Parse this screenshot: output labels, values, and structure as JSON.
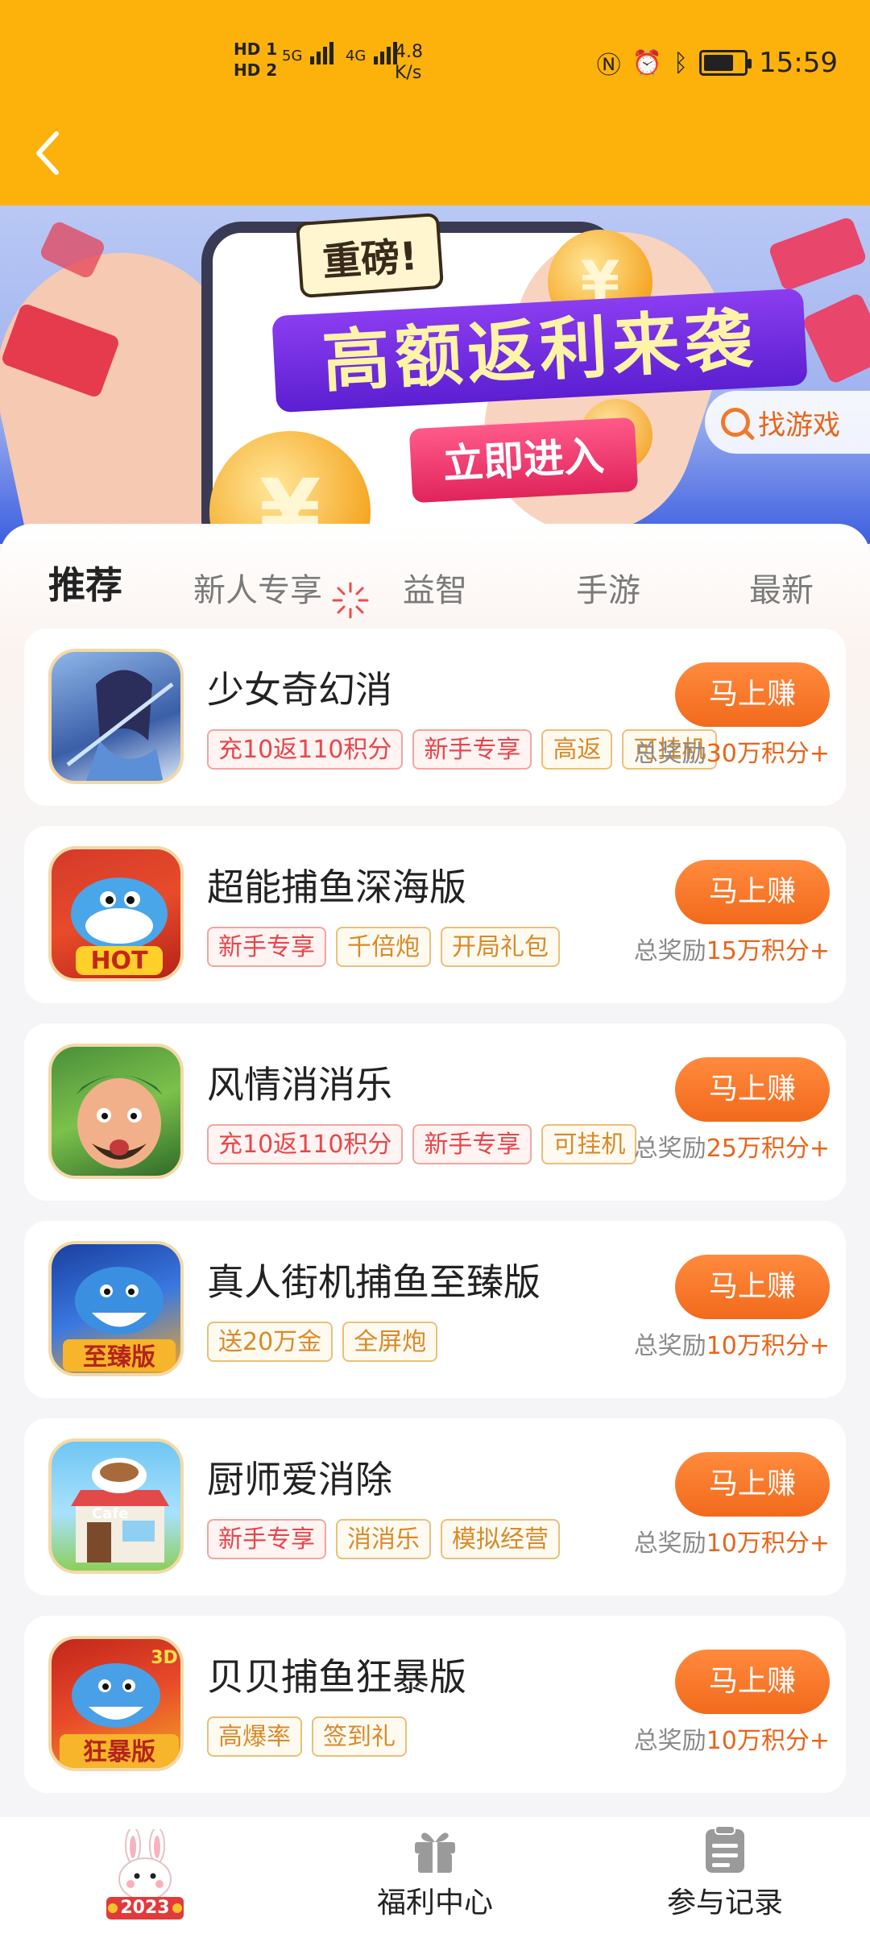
{
  "status_bar": {
    "hd1": "HD 1",
    "hd2": "HD 2",
    "sim1": "5G",
    "sim2": "4G",
    "speed_value": "4.8",
    "speed_unit": "K/s",
    "time": "15:59"
  },
  "banner": {
    "badge": "重磅!",
    "headline": "高额返利来袭",
    "cta": "立即进入",
    "search_label": "找游戏"
  },
  "tabs": [
    {
      "label": "推荐",
      "active": true
    },
    {
      "label": "新人专享",
      "active": false
    },
    {
      "label": "益智",
      "active": false
    },
    {
      "label": "手游",
      "active": false
    },
    {
      "label": "最新",
      "active": false
    }
  ],
  "games": [
    {
      "name": "少女奇幻消",
      "tags": [
        "充10返110积分",
        "新手专享",
        "高返",
        "可挂机"
      ],
      "button": "马上赚",
      "reward_prefix": "总奖励",
      "reward_value": "30万积分+"
    },
    {
      "name": "超能捕鱼深海版",
      "tags": [
        "新手专享",
        "千倍炮",
        "开局礼包"
      ],
      "button": "马上赚",
      "reward_prefix": "总奖励",
      "reward_value": "15万积分+"
    },
    {
      "name": "风情消消乐",
      "tags": [
        "充10返110积分",
        "新手专享",
        "可挂机"
      ],
      "button": "马上赚",
      "reward_prefix": "总奖励",
      "reward_value": "25万积分+"
    },
    {
      "name": "真人街机捕鱼至臻版",
      "tags": [
        "送20万金",
        "全屏炮"
      ],
      "button": "马上赚",
      "reward_prefix": "总奖励",
      "reward_value": "10万积分+"
    },
    {
      "name": "厨师爱消除",
      "tags": [
        "新手专享",
        "消消乐",
        "模拟经营"
      ],
      "button": "马上赚",
      "reward_prefix": "总奖励",
      "reward_value": "10万积分+"
    },
    {
      "name": "贝贝捕鱼狂暴版",
      "tags": [
        "高爆率",
        "签到礼"
      ],
      "button": "马上赚",
      "reward_prefix": "总奖励",
      "reward_value": "10万积分+"
    }
  ],
  "bottom_nav": {
    "home_badge": "2023",
    "welfare": "福利中心",
    "records": "参与记录"
  }
}
